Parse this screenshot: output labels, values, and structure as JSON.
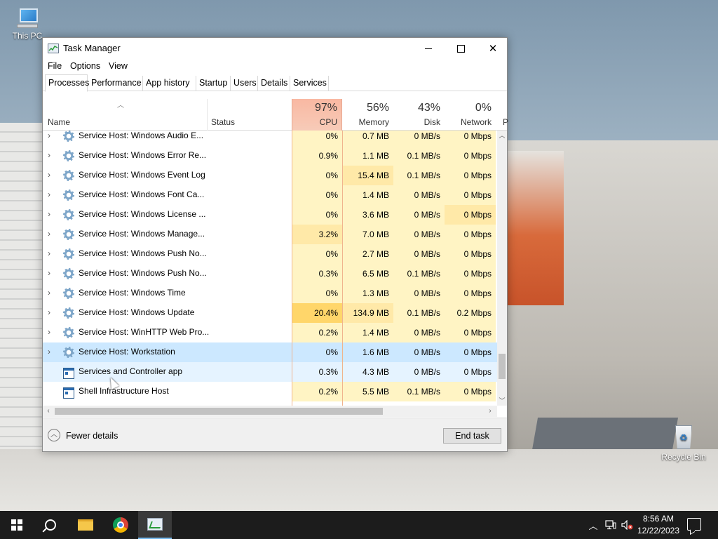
{
  "desktop": {
    "icons": [
      {
        "label": "This PC",
        "icon": "computer-icon"
      },
      {
        "label": "Recycle Bin",
        "icon": "recycle-bin-icon"
      }
    ]
  },
  "window": {
    "title": "Task Manager",
    "menu": [
      "File",
      "Options",
      "View"
    ],
    "tabs": [
      "Processes",
      "Performance",
      "App history",
      "Startup",
      "Users",
      "Details",
      "Services"
    ],
    "active_tab": "Processes"
  },
  "columns": {
    "name": "Name",
    "status": "Status",
    "cpu": {
      "pct": "97%",
      "label": "CPU"
    },
    "memory": {
      "pct": "56%",
      "label": "Memory"
    },
    "disk": {
      "pct": "43%",
      "label": "Disk"
    },
    "network": {
      "pct": "0%",
      "label": "Network"
    },
    "power_partial": "P"
  },
  "rows": [
    {
      "name": "Service Host: Windows Audio E...",
      "icon": "gear-icon",
      "expandable": true,
      "cpu": "0%",
      "memory": "0.7 MB",
      "disk": "0 MB/s",
      "network": "0 Mbps"
    },
    {
      "name": "Service Host: Windows Error Re...",
      "icon": "gear-icon",
      "expandable": true,
      "cpu": "0.9%",
      "memory": "1.1 MB",
      "disk": "0.1 MB/s",
      "network": "0 Mbps"
    },
    {
      "name": "Service Host: Windows Event Log",
      "icon": "gear-icon",
      "expandable": true,
      "cpu": "0%",
      "memory": "15.4 MB",
      "disk": "0.1 MB/s",
      "network": "0 Mbps"
    },
    {
      "name": "Service Host: Windows Font Ca...",
      "icon": "gear-icon",
      "expandable": true,
      "cpu": "0%",
      "memory": "1.4 MB",
      "disk": "0 MB/s",
      "network": "0 Mbps"
    },
    {
      "name": "Service Host: Windows License ...",
      "icon": "gear-icon",
      "expandable": true,
      "cpu": "0%",
      "memory": "3.6 MB",
      "disk": "0 MB/s",
      "network": "0 Mbps"
    },
    {
      "name": "Service Host: Windows Manage...",
      "icon": "gear-icon",
      "expandable": true,
      "cpu": "3.2%",
      "memory": "7.0 MB",
      "disk": "0 MB/s",
      "network": "0 Mbps"
    },
    {
      "name": "Service Host: Windows Push No...",
      "icon": "gear-icon",
      "expandable": true,
      "cpu": "0%",
      "memory": "2.7 MB",
      "disk": "0 MB/s",
      "network": "0 Mbps"
    },
    {
      "name": "Service Host: Windows Push No...",
      "icon": "gear-icon",
      "expandable": true,
      "cpu": "0.3%",
      "memory": "6.5 MB",
      "disk": "0.1 MB/s",
      "network": "0 Mbps"
    },
    {
      "name": "Service Host: Windows Time",
      "icon": "gear-icon",
      "expandable": true,
      "cpu": "0%",
      "memory": "1.3 MB",
      "disk": "0 MB/s",
      "network": "0 Mbps"
    },
    {
      "name": "Service Host: Windows Update",
      "icon": "gear-icon",
      "expandable": true,
      "cpu": "20.4%",
      "memory": "134.9 MB",
      "disk": "0.1 MB/s",
      "network": "0.2 Mbps"
    },
    {
      "name": "Service Host: WinHTTP Web Pro...",
      "icon": "gear-icon",
      "expandable": true,
      "cpu": "0.2%",
      "memory": "1.4 MB",
      "disk": "0 MB/s",
      "network": "0 Mbps"
    },
    {
      "name": "Service Host: Workstation",
      "icon": "gear-icon",
      "expandable": true,
      "cpu": "0%",
      "memory": "1.6 MB",
      "disk": "0 MB/s",
      "network": "0 Mbps",
      "state": "selected"
    },
    {
      "name": "Services and Controller app",
      "icon": "app-window-icon",
      "expandable": false,
      "cpu": "0.3%",
      "memory": "4.3 MB",
      "disk": "0 MB/s",
      "network": "0 Mbps",
      "state": "hover"
    },
    {
      "name": "Shell Infrastructure Host",
      "icon": "app-window-icon",
      "expandable": false,
      "cpu": "0.2%",
      "memory": "5.5 MB",
      "disk": "0.1 MB/s",
      "network": "0 Mbps"
    }
  ],
  "footer": {
    "fewer_details": "Fewer details",
    "end_task": "End task"
  },
  "taskbar": {
    "apps": [
      "start-icon",
      "search-icon",
      "file-explorer-icon",
      "chrome-icon",
      "task-manager-icon"
    ],
    "time": "8:56 AM",
    "date": "12/22/2023"
  },
  "colors": {
    "cpu_header": "#f9b8a2",
    "heat_light": "#fff4c4",
    "heat_mid": "#ffe9a8",
    "heat_strong": "#ffd66a",
    "selected_row": "#cce8ff",
    "taskbar": "#1c1c1c"
  }
}
